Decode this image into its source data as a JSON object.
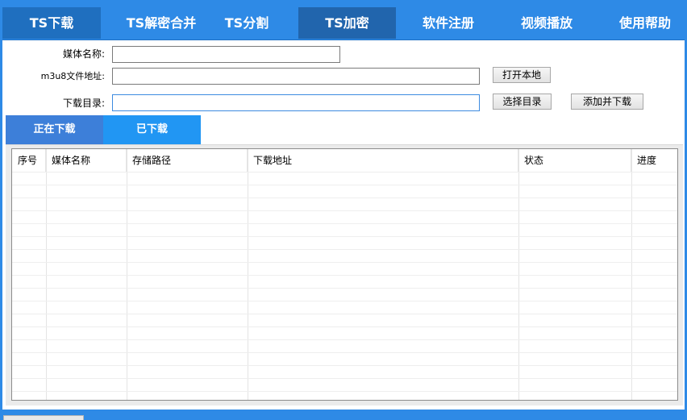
{
  "nav": {
    "tabs": [
      {
        "label": "TS下载"
      },
      {
        "label": "TS解密合并"
      },
      {
        "label": "TS分割"
      },
      {
        "label": "TS加密"
      },
      {
        "label": "软件注册"
      },
      {
        "label": "视频播放"
      },
      {
        "label": "使用帮助"
      }
    ]
  },
  "form": {
    "media_name_label": "媒体名称:",
    "media_name_value": "",
    "m3u8_label": "m3u8文件地址:",
    "m3u8_value": "",
    "open_local_button": "打开本地",
    "dir_label": "下载目录:",
    "dir_value": "",
    "choose_dir_button": "选择目录",
    "add_download_button": "添加并下载"
  },
  "subtabs": {
    "downloading": "正在下载",
    "downloaded": "已下载"
  },
  "table": {
    "columns": [
      "序号",
      "媒体名称",
      "存储路径",
      "下载地址",
      "状态",
      "进度"
    ],
    "rows": []
  },
  "colors": {
    "accent": "#2e8ae6",
    "nav_active": "#1f6fbf",
    "subtab_active": "#3d7fd9",
    "subtab_inactive": "#2196f3"
  }
}
